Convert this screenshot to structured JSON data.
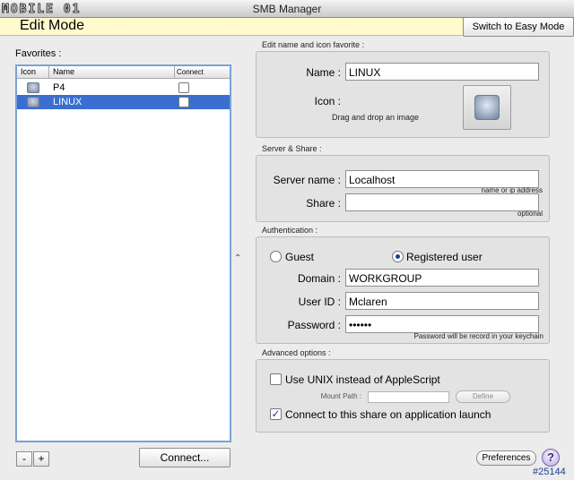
{
  "window": {
    "title": "SMB Manager",
    "watermark_logo": "MOBILE 01"
  },
  "mode": {
    "title": "Edit Mode",
    "switch_label": "Switch to Easy Mode"
  },
  "favorites": {
    "label": "Favorites :",
    "columns": [
      "Icon",
      "Name",
      "Connect"
    ],
    "rows": [
      {
        "name": "P4",
        "selected": false
      },
      {
        "name": "LINUX",
        "selected": true
      }
    ],
    "remove_label": "-",
    "add_label": "+",
    "connect_label": "Connect..."
  },
  "edit_name": {
    "group_label": "Edit name and icon favorite :",
    "name_label": "Name :",
    "name_value": "LINUX",
    "icon_label": "Icon :",
    "icon_hint": "Drag and drop an image"
  },
  "server": {
    "group_label": "Server & Share :",
    "server_label": "Server name :",
    "server_value": "Localhost",
    "server_hint": "name or ip address",
    "share_label": "Share :",
    "share_value": "",
    "share_hint": "optional"
  },
  "auth": {
    "group_label": "Authentication :",
    "guest_label": "Guest",
    "registered_label": "Registered user",
    "selected": "registered",
    "domain_label": "Domain :",
    "domain_value": "WORKGROUP",
    "userid_label": "User ID :",
    "userid_value": "Mclaren",
    "password_label": "Password :",
    "password_value": "••••••",
    "password_hint": "Password will be record in your keychain"
  },
  "advanced": {
    "group_label": "Advanced options :",
    "unix_label": "Use UNIX instead of AppleScript",
    "unix_checked": false,
    "mount_label": "Mount Path :",
    "define_label": "Define",
    "launch_label": "Connect to this share on application launch",
    "launch_checked": true,
    "check_mark": "✓"
  },
  "footer": {
    "prefs_label": "Preferences",
    "help_label": "?",
    "watermark_id": "#25144"
  },
  "colors": {
    "selection": "#3a6fd1",
    "mode_bar": "#fffbcc",
    "accent": "#1e3d8f"
  }
}
